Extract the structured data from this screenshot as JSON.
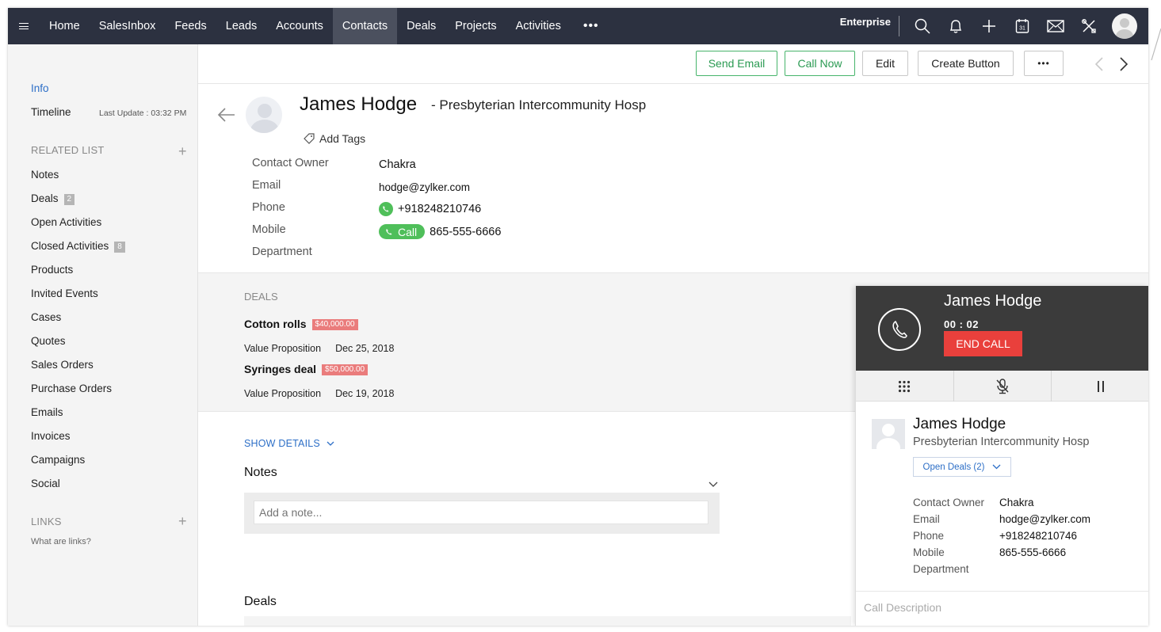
{
  "topnav": {
    "items": [
      "Home",
      "SalesInbox",
      "Feeds",
      "Leads",
      "Accounts",
      "Contacts",
      "Deals",
      "Projects",
      "Activities"
    ],
    "active": "Contacts",
    "more": "•••",
    "edition": "Enterprise",
    "icons": [
      "search-icon",
      "bell-icon",
      "plus-icon",
      "calendar-icon",
      "mail-icon",
      "tools-icon"
    ],
    "calendar_day": "31"
  },
  "sidebar": {
    "info": "Info",
    "timeline": "Timeline",
    "last_update": "Last Update : 03:32 PM",
    "related_header": "RELATED LIST",
    "plus": "+",
    "items": [
      {
        "label": "Notes",
        "badge": ""
      },
      {
        "label": "Deals",
        "badge": "2"
      },
      {
        "label": "Open Activities",
        "badge": ""
      },
      {
        "label": "Closed Activities",
        "badge": "8"
      },
      {
        "label": "Products",
        "badge": ""
      },
      {
        "label": "Invited Events",
        "badge": ""
      },
      {
        "label": "Cases",
        "badge": ""
      },
      {
        "label": "Quotes",
        "badge": ""
      },
      {
        "label": "Sales Orders",
        "badge": ""
      },
      {
        "label": "Purchase Orders",
        "badge": ""
      },
      {
        "label": "Emails",
        "badge": ""
      },
      {
        "label": "Invoices",
        "badge": ""
      },
      {
        "label": "Campaigns",
        "badge": ""
      },
      {
        "label": "Social",
        "badge": ""
      }
    ],
    "links_header": "LINKS",
    "links_help": "What are links?"
  },
  "actionbar": {
    "send_email": "Send Email",
    "call_now": "Call Now",
    "edit": "Edit",
    "create_button": "Create Button",
    "more": "•••"
  },
  "contact": {
    "name": "James Hodge",
    "company": "- Presbyterian Intercommunity Hosp",
    "add_tags": "Add Tags",
    "fields": {
      "owner_label": "Contact Owner",
      "owner": "Chakra",
      "email_label": "Email",
      "email": "hodge@zylker.com",
      "phone_label": "Phone",
      "phone": "+918248210746",
      "mobile_label": "Mobile",
      "mobile": "865-555-6666",
      "call_label": "Call",
      "department_label": "Department"
    }
  },
  "deals": {
    "title": "DEALS",
    "items": [
      {
        "name": "Cotton rolls",
        "amount": "$40,000.00",
        "stage": "Value Proposition",
        "date": "Dec 25, 2018"
      },
      {
        "name": "Syringes deal",
        "amount": "$50,000.00",
        "stage": "Value Proposition",
        "date": "Dec 19, 2018"
      }
    ]
  },
  "details": {
    "show_details": "SHOW DETAILS",
    "notes_title": "Notes",
    "notes_placeholder": "Add a note...",
    "deals_title": "Deals"
  },
  "call_panel": {
    "name": "James Hodge",
    "timer": "00 : 02",
    "end_call": "END CALL",
    "contact_name": "James Hodge",
    "company": "Presbyterian Intercommunity Hosp",
    "open_deals": "Open Deals (2)",
    "owner_label": "Contact Owner",
    "owner": "Chakra",
    "email_label": "Email",
    "email": "hodge@zylker.com",
    "phone_label": "Phone",
    "phone": "+918248210746",
    "mobile_label": "Mobile",
    "mobile": "865-555-6666",
    "department_label": "Department",
    "description_placeholder": "Call Description"
  },
  "colors": {
    "nav_bg": "#2c3140",
    "accent_blue": "#2d6fc7",
    "green": "#4fbf5a",
    "end_call": "#e9403c",
    "deal_badge": "#ea7c7c"
  }
}
